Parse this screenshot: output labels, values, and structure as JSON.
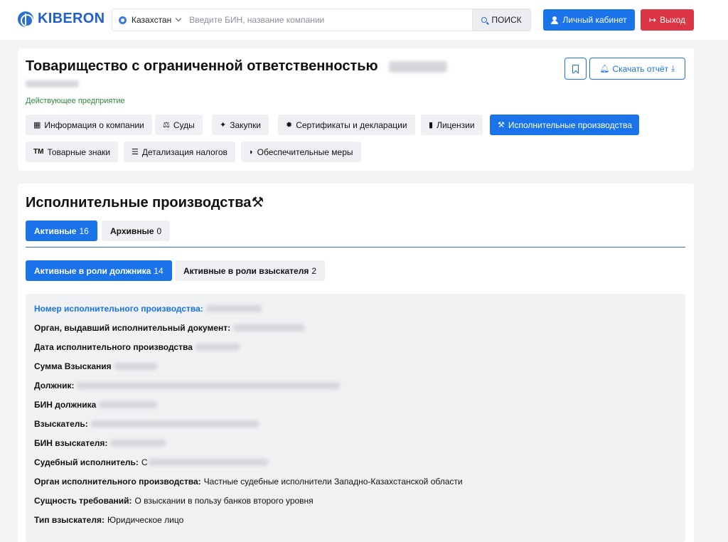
{
  "header": {
    "logo_text": "KIBERON",
    "country": "Казахстан",
    "search_placeholder": "Введите БИН, название компании",
    "search_button": "ПОИСК",
    "cabinet_button": "Личный кабинет",
    "exit_button": "Выход",
    "colors": {
      "brand": "#1f5fc9",
      "primary": "#1a73e8",
      "danger": "#dc3545"
    }
  },
  "company": {
    "title": "Товарищество с ограниченной ответственностью",
    "status": "Действующее предприятие",
    "download_button": "Скачать отчёт",
    "status_color": "#2e8b3d"
  },
  "nav_tabs": [
    {
      "label": "Информация о компании",
      "icon": "building-icon",
      "active": false
    },
    {
      "label": "Суды",
      "icon": "scales-icon",
      "active": false
    },
    {
      "label": "Закупки",
      "icon": "handshake-icon",
      "active": false
    },
    {
      "label": "Сертификаты и декларации",
      "icon": "certificate-icon",
      "active": false
    },
    {
      "label": "Лицензии",
      "icon": "document-icon",
      "active": false
    },
    {
      "label": "Исполнительные производства",
      "icon": "gavel-icon",
      "active": true
    },
    {
      "label": "Товарные знаки",
      "icon": "trademark-icon",
      "active": false
    },
    {
      "label": "Детализация налогов",
      "icon": "coins-icon",
      "active": false
    },
    {
      "label": "Обеспечительные меры",
      "icon": "shield-icon",
      "active": false
    }
  ],
  "section": {
    "title": "Исполнительные производства",
    "status_tabs": [
      {
        "label": "Активные",
        "count": "16",
        "active": true
      },
      {
        "label": "Архивные",
        "count": "0",
        "active": false
      }
    ],
    "role_tabs": [
      {
        "label": "Активные в роли должника",
        "count": "14",
        "active": true
      },
      {
        "label": "Активные в роли взыскателя",
        "count": "2",
        "active": false
      }
    ]
  },
  "record": {
    "fields": [
      {
        "key": "Номер исполнительного производства:",
        "value": "",
        "link": true
      },
      {
        "key": "Орган, выдавший исполнительный документ:",
        "value": ""
      },
      {
        "key": "Дата исполнительного производства",
        "value": ""
      },
      {
        "key": "Сумма Взыскания",
        "value": ""
      },
      {
        "key": "Должник:",
        "value": ""
      },
      {
        "key": "БИН должника",
        "value": ""
      },
      {
        "key": "Взыскатель:",
        "value": ""
      },
      {
        "key": "БИН взыскателя:",
        "value": ""
      },
      {
        "key": "Судебный исполнитель:",
        "value": "С"
      },
      {
        "key": "Орган исполнительного производства:",
        "value": "Частные судебные исполнители Западно-Казахстанской области"
      },
      {
        "key": "Сущность требований:",
        "value": "О взыскании в пользу банков второго уровня"
      },
      {
        "key": "Тип взыскателя:",
        "value": "Юридическое лицо"
      }
    ]
  }
}
